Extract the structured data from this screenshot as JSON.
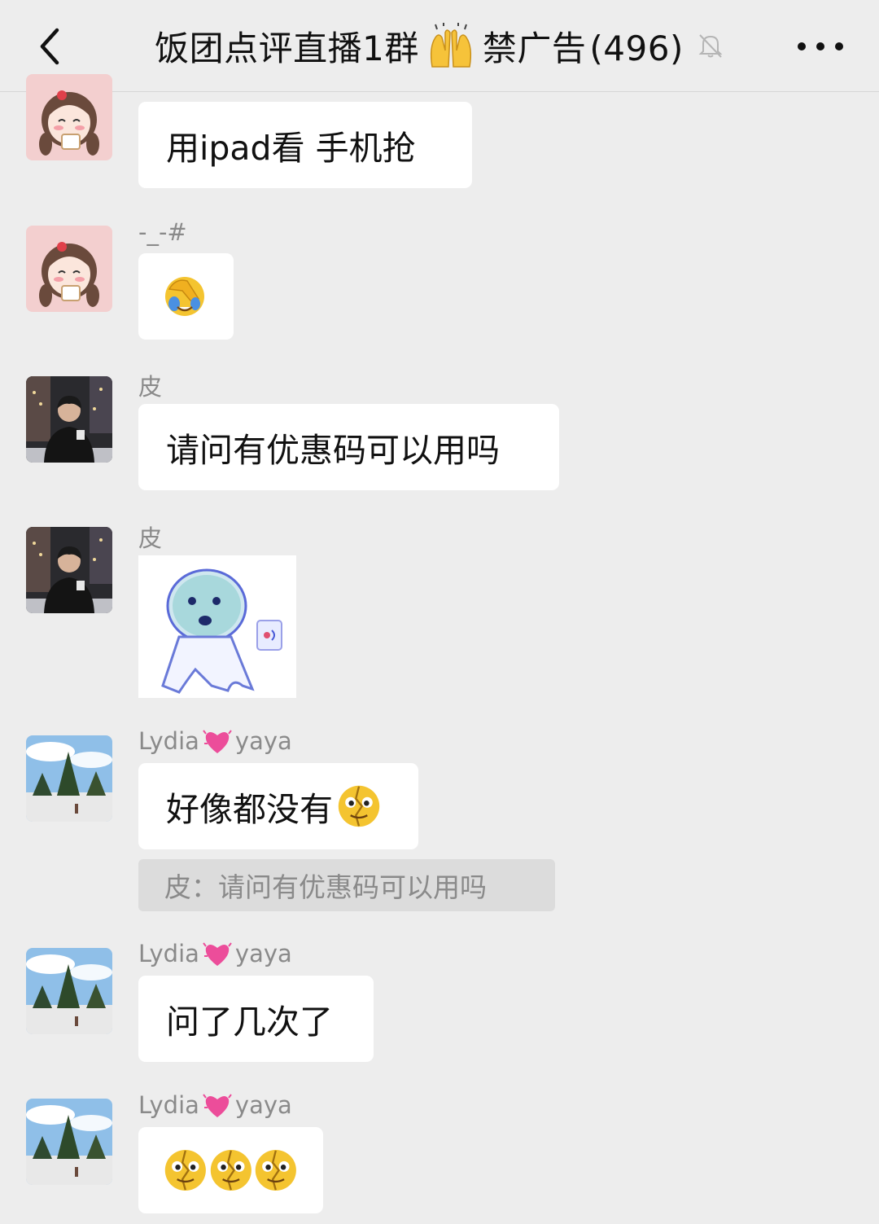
{
  "header": {
    "title_prefix": "饭团点评直播1群",
    "title_suffix": "禁广告",
    "member_count": "(496)",
    "icons": [
      "back-arrow-icon",
      "raising-hands-emoji-icon",
      "mute-bell-icon",
      "more-dots-icon"
    ]
  },
  "messages": [
    {
      "sender": "",
      "text": "用ipad看  手机抢",
      "avatar": "cartoon-girl-avatar"
    },
    {
      "sender": "-_-#",
      "emoji": "facepalm-emoji",
      "avatar": "cartoon-girl-avatar"
    },
    {
      "sender": "皮",
      "text": "请问有优惠码可以用吗",
      "avatar": "man-in-black-coat-avatar"
    },
    {
      "sender": "皮",
      "sticker": "ghost-sticker",
      "avatar": "man-in-black-coat-avatar"
    },
    {
      "sender_prefix": "Lydia",
      "sender_suffix": "yaya",
      "text": "好像都没有",
      "quote": "皮：请问有优惠码可以用吗",
      "avatar": "landscape-avatar"
    },
    {
      "sender_prefix": "Lydia",
      "sender_suffix": "yaya",
      "text": "问了几次了",
      "avatar": "landscape-avatar"
    },
    {
      "sender_prefix": "Lydia",
      "sender_suffix": "yaya",
      "emoji": "cracked-face-emoji x3",
      "avatar": "landscape-avatar"
    }
  ],
  "colors": {
    "background": "#ededed",
    "bubble": "#ffffff",
    "sender_name": "#8a8a8a",
    "quote_bg": "#dcdcdc"
  }
}
